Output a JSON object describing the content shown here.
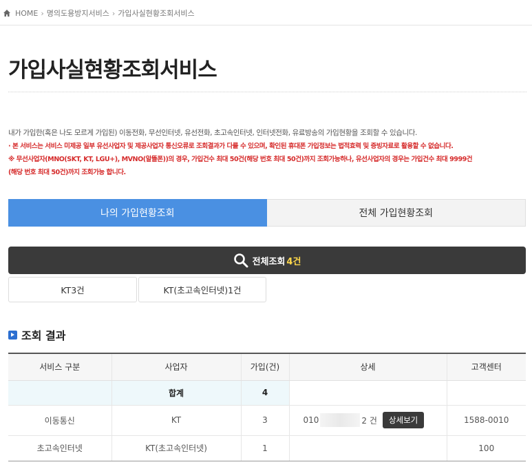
{
  "breadcrumb": {
    "home": "HOME",
    "items": [
      "명의도용방지서비스",
      "가입사실현황조회서비스"
    ]
  },
  "page": {
    "title": "가입사실현황조회서비스"
  },
  "description": {
    "main": "내가 가입한(혹은 나도 모르게 가입된) 이동전화, 무선인터넷, 유선전화, 초고속인터넷, 인터넷전화, 유료방송의 가입현황을 조회할 수 있습니다.",
    "notice1": "· 본 서비스는 서비스 미제공 일부 유선사업자 및 제공사업자 통신오류로 조회결과가 다를 수 있으며, 확인된 휴대폰 가입정보는 법적효력 및 증빙자료로 활용할 수 없습니다.",
    "notice2": "※ 무선사업자(MNO(SKT, KT, LGU+), MVNO(알뜰폰))의 경우, 가입건수 최대 50건(해당 번호 최대 50건)까지 조회가능하나, 유선사업자의 경우는 가입건수 최대 9999건",
    "notice3": "(해당 번호 최대 50건)까지 조회가능 합니다."
  },
  "tabs": [
    {
      "label": "나의 가입현황조회",
      "active": true
    },
    {
      "label": "전체 가입현황조회",
      "active": false
    }
  ],
  "search": {
    "icon": "search-icon",
    "label": "전체조회",
    "count": "4건"
  },
  "filters": [
    {
      "label": "KT3건"
    },
    {
      "label": "KT(초고속인터넷)1건"
    }
  ],
  "results": {
    "heading": "조회 결과",
    "columns": [
      "서비스 구분",
      "사업자",
      "가입(건)",
      "상세",
      "고객센터"
    ],
    "summary": {
      "label": "합계",
      "count": "4"
    },
    "rows": [
      {
        "service": "이동통신",
        "provider": "KT",
        "count": "3",
        "detail_prefix": "010",
        "detail_suffix": "2 건",
        "detail_button": "상세보기",
        "support": "1588-0010"
      },
      {
        "service": "초고속인터넷",
        "provider": "KT(초고속인터넷)",
        "count": "1",
        "detail_prefix": "",
        "detail_suffix": "",
        "detail_button": "",
        "support": "100"
      }
    ]
  },
  "colors": {
    "accent": "#4a90e2",
    "dark": "#3a3a3a",
    "notice_red": "#d62c2c",
    "count_yellow": "#ffd84a"
  }
}
